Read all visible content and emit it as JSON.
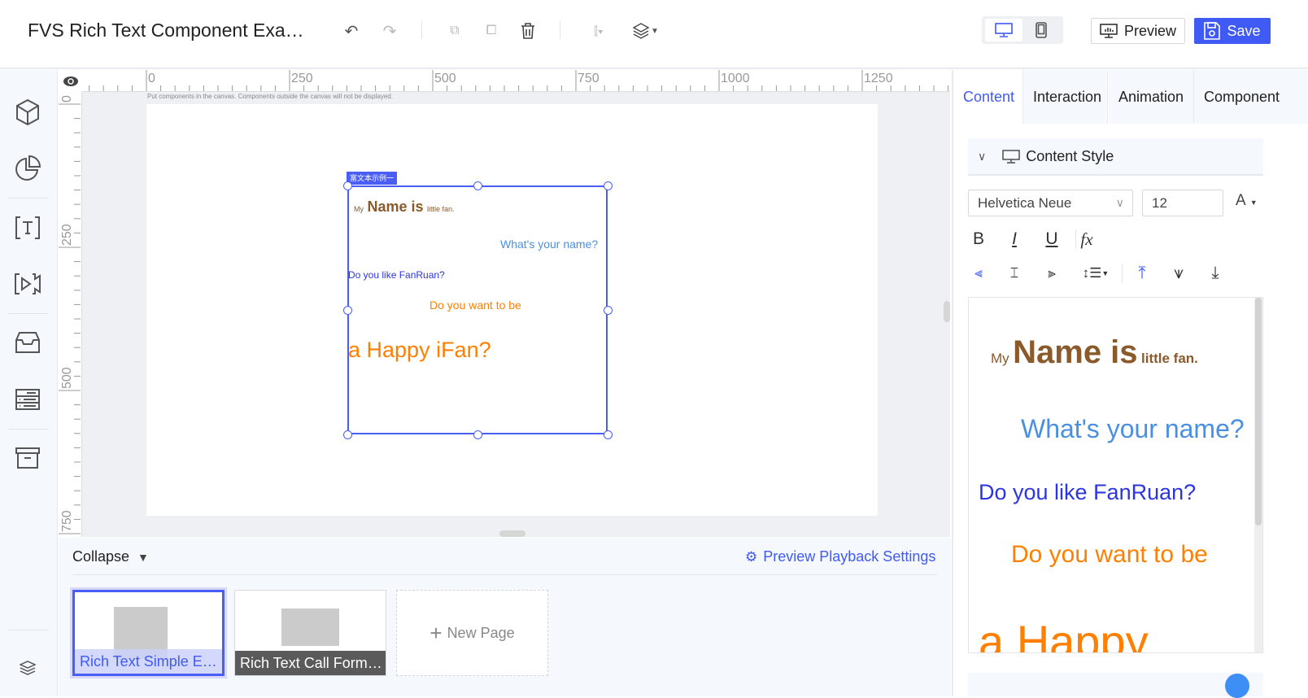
{
  "header": {
    "title": "FVS Rich Text Component Exa…",
    "preview_label": "Preview",
    "save_label": "Save"
  },
  "ruler": {
    "h_labels": [
      "0",
      "250",
      "500",
      "750",
      "1000",
      "1250"
    ],
    "v_labels": [
      "0",
      "250",
      "500",
      "750"
    ]
  },
  "canvas": {
    "hint": "Put components in the canvas. Components outside the canvas will not be displayed.",
    "component_tag": "富文本示例一"
  },
  "rich_text": {
    "line1": {
      "small": "My",
      "big": "Name is",
      "tail": "little fan."
    },
    "line2": "What's your name?",
    "line3": "Do you like FanRuan?",
    "line4": "Do you want to be",
    "line5": "a Happy iFan?",
    "line5_preview": "a Happy"
  },
  "bottom": {
    "collapse_label": "Collapse",
    "playback_settings": "Preview Playback Settings",
    "pages": [
      {
        "label": "Rich Text Simple E…",
        "active": true
      },
      {
        "label": "Rich Text Call Form…",
        "active": false
      }
    ],
    "new_page": "New Page"
  },
  "right_panel": {
    "tabs": [
      "Content",
      "Interaction",
      "Animation",
      "Component"
    ],
    "section_title": "Content Style",
    "font_family": "Helvetica Neue",
    "font_size": "12",
    "font_color_label": "A",
    "format": {
      "bold": "B",
      "italic": "I",
      "underline": "U",
      "formula": "fx"
    }
  },
  "colors": {
    "accent": "#3f5af5",
    "brown": "#8a5a2b",
    "light_blue": "#4a90e2",
    "blue": "#2b35e0",
    "orange": "#ff7f00"
  }
}
